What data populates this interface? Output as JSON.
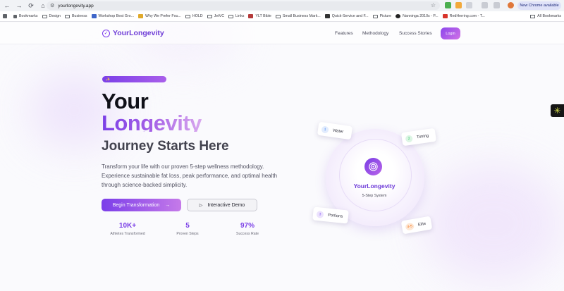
{
  "browser": {
    "url": "yourlongevity.app",
    "new_chrome": "New Chrome available",
    "bookmarks": [
      "Bookmarks",
      "Design",
      "Business",
      "Workshop Best Gro...",
      "Why We Prefer Fou...",
      "HOLD",
      "JetVC",
      "Links",
      "YLT Bible",
      "Small Business Mark...",
      "Quick-Service and F...",
      "Picture",
      "Nanninga 2010s - P...",
      "RedHerring.com - T..."
    ],
    "all_bookmarks": "All Bookmarks"
  },
  "header": {
    "logo": "YourLongevity",
    "nav": [
      "Features",
      "Methodology",
      "Success Stories"
    ],
    "login": "Login"
  },
  "hero": {
    "badge": "✨",
    "title_1": "Your",
    "title_2": "Longevity",
    "title_3": "Journey Starts Here",
    "description": "Transform your life with our proven 5-step wellness methodology. Experience sustainable fat loss, peak performance, and optimal health through science-backed simplicity.",
    "cta_primary": "Begin Transformation",
    "cta_secondary": "Interactive Demo",
    "stats": [
      {
        "value": "10K+",
        "label": "Athletes Transformed"
      },
      {
        "value": "5",
        "label": "Proven Steps"
      },
      {
        "value": "97%",
        "label": "Success Rate"
      }
    ]
  },
  "system": {
    "title": "YourLongevity",
    "subtitle": "5-Step System",
    "steps": [
      {
        "num": "1",
        "label": "Water",
        "color": "#3b82f6"
      },
      {
        "num": "2",
        "label": "Timing",
        "color": "#22c55e"
      },
      {
        "num": "3",
        "label": "Portions",
        "color": "#8b5cf6"
      },
      {
        "num": "4-5",
        "label": "Elite",
        "color": "#f97316"
      }
    ]
  },
  "colors": {
    "brand": "#7c3aed",
    "accent": "#c57ae9"
  }
}
